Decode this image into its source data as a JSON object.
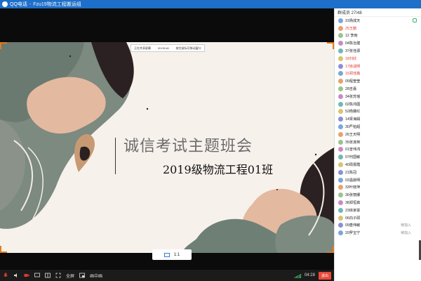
{
  "titlebar": {
    "app": "QQ电话",
    "title": "Fzu19物流工程搬运组"
  },
  "share_bar": {
    "left": "正在共享屏幕",
    "time": "00:05:48",
    "right": "按住鼠标可移动窗口"
  },
  "slide": {
    "title": "诚信考试主题班会",
    "subtitle": "2019级物流工程01班"
  },
  "zoom": {
    "label": "1:1"
  },
  "toolbar": {
    "fullscreen": "全屏",
    "pip": "画中画",
    "duration": "04:28",
    "exit": "退出"
  },
  "panel": {
    "header": "群成员 27/48",
    "members": [
      {
        "name": "31杨成天",
        "red": false,
        "status": "",
        "mic": true
      },
      {
        "name": "25王鹏",
        "red": true,
        "status": "",
        "mic": false
      },
      {
        "name": "12 李雨",
        "red": false,
        "status": "",
        "mic": false
      },
      {
        "name": "04陈治建",
        "red": false,
        "status": "",
        "mic": false
      },
      {
        "name": "37张佳源",
        "red": false,
        "status": "",
        "mic": false
      },
      {
        "name": "18刘欣",
        "red": true,
        "status": "",
        "mic": false
      },
      {
        "name": "17徐涵明",
        "red": true,
        "status": "",
        "mic": false
      },
      {
        "name": "15郑佳鑫",
        "red": true,
        "status": "",
        "mic": false
      },
      {
        "name": "05程莹莹",
        "red": false,
        "status": "",
        "mic": false
      },
      {
        "name": "28吉嘉",
        "red": false,
        "status": "",
        "mic": false
      },
      {
        "name": "34张苏瑶",
        "red": false,
        "status": "",
        "mic": false
      },
      {
        "name": "02陈鸿图",
        "red": false,
        "status": "",
        "mic": false
      },
      {
        "name": "52杨娜红",
        "red": false,
        "status": "",
        "mic": false
      },
      {
        "name": "14梁海娟",
        "red": false,
        "status": "",
        "mic": false
      },
      {
        "name": "30严柏超",
        "red": false,
        "status": "",
        "mic": false
      },
      {
        "name": "26王天明",
        "red": false,
        "status": "",
        "mic": false
      },
      {
        "name": "35张淑英",
        "red": false,
        "status": "",
        "mic": false
      },
      {
        "name": "01曾伟鸿",
        "red": false,
        "status": "",
        "mic": false
      },
      {
        "name": "07何国敏",
        "red": false,
        "status": "",
        "mic": false
      },
      {
        "name": "40周振霞",
        "red": false,
        "status": "",
        "mic": false
      },
      {
        "name": "21陈冠",
        "red": false,
        "status": "",
        "mic": false
      },
      {
        "name": "03温晨明",
        "red": false,
        "status": "",
        "mic": false
      },
      {
        "name": "33叶晓萍",
        "red": false,
        "status": "",
        "mic": false
      },
      {
        "name": "36张丽娜",
        "red": false,
        "status": "",
        "mic": false
      },
      {
        "name": "38郑恒真",
        "red": false,
        "status": "",
        "mic": false
      },
      {
        "name": "23徐家豪",
        "red": false,
        "status": "",
        "mic": false
      },
      {
        "name": "06向子硕",
        "red": false,
        "status": "",
        "mic": false
      },
      {
        "name": "09唐伟敏",
        "red": false,
        "status": "待加入",
        "mic": false
      },
      {
        "name": "20罗宝宁",
        "red": false,
        "status": "待加入",
        "mic": false
      }
    ]
  },
  "colors": {
    "titlebar": "#1e6fc9",
    "accent_red": "#e23a2e",
    "corner": "#e07b1e"
  }
}
